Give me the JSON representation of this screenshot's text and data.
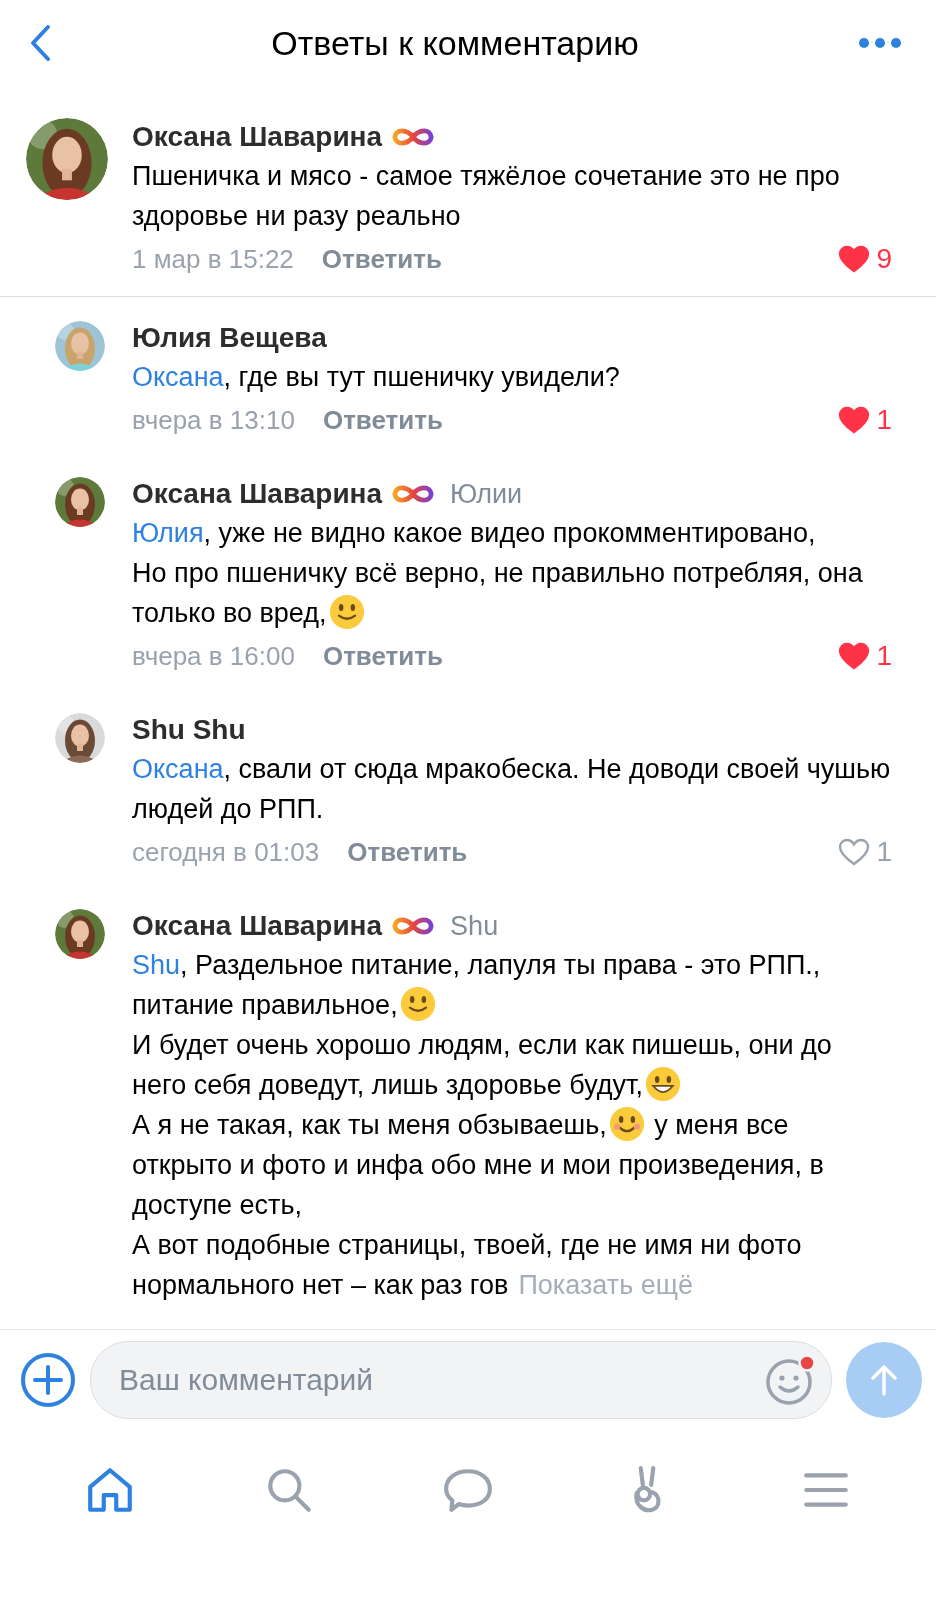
{
  "header": {
    "title": "Ответы к комментарию"
  },
  "comments": [
    {
      "name": "Оксана Шаварина",
      "badge": true,
      "paragraphs": [
        [
          {
            "kind": "text",
            "text": "Пшеничка и мясо - самое тяжёлое сочетание это не про здоровье ни разу реально"
          }
        ]
      ],
      "time": "1 мар в 15:22",
      "reply": "Ответить",
      "likes": "9",
      "liked": true
    },
    {
      "name": "Юлия Вещева",
      "badge": false,
      "paragraphs": [
        [
          {
            "kind": "mention",
            "text": "Оксана"
          },
          {
            "kind": "text",
            "text": ", где вы тут пшеничку увидели?"
          }
        ]
      ],
      "time": "вчера в 13:10",
      "reply": "Ответить",
      "likes": "1",
      "liked": true
    },
    {
      "name": "Оксана Шаварина",
      "badge": true,
      "reply_to": "Юлии",
      "paragraphs": [
        [
          {
            "kind": "mention",
            "text": "Юлия"
          },
          {
            "kind": "text",
            "text": ", уже не видно какое видео прокомментировано,"
          }
        ],
        [
          {
            "kind": "text",
            "text": "Но про пшеничку всё верно, не правильно потребляя, она только во вред,"
          },
          {
            "kind": "smile"
          }
        ]
      ],
      "time": "вчера в 16:00",
      "reply": "Ответить",
      "likes": "1",
      "liked": true
    },
    {
      "name": "Shu Shu",
      "badge": false,
      "paragraphs": [
        [
          {
            "kind": "mention",
            "text": "Оксана"
          },
          {
            "kind": "text",
            "text": ", свали от сюда мракобеска. Не доводи своей чушью людей до РПП."
          }
        ]
      ],
      "time": "сегодня в 01:03",
      "reply": "Ответить",
      "likes": "1",
      "liked": false
    },
    {
      "name": "Оксана Шаварина",
      "badge": true,
      "reply_to": "Shu",
      "paragraphs": [
        [
          {
            "kind": "mention",
            "text": "Shu"
          },
          {
            "kind": "text",
            "text": ", Раздельное питание, лапуля ты права - это РПП., питание правильное,"
          },
          {
            "kind": "smile"
          }
        ],
        [
          {
            "kind": "text",
            "text": "И будет очень хорошо людям, если как пишешь, они до него себя доведут, лишь здоровье будут,"
          },
          {
            "kind": "grin"
          }
        ],
        [
          {
            "kind": "text",
            "text": "А я не такая, как ты меня обзываешь,"
          },
          {
            "kind": "blush"
          },
          {
            "kind": "text",
            "text": " у меня все открыто и фото и инфа обо мне и мои произведения, в доступе есть,"
          }
        ],
        [
          {
            "kind": "text",
            "text": "А вот подобные страницы, твоей, где не имя ни фото нормального нет – как раз гов"
          }
        ]
      ],
      "more": "Показать ещё"
    }
  ],
  "composer": {
    "placeholder": "Ваш комментарий",
    "emoji_notification": true
  },
  "tabs": [
    {
      "selected": true
    },
    {
      "selected": false
    },
    {
      "selected": false
    },
    {
      "selected": false
    },
    {
      "selected": false
    }
  ]
}
